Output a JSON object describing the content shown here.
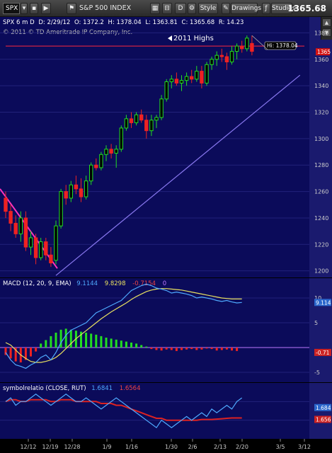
{
  "toolbar": {
    "symbol": "SPX",
    "symbol_name": "S&P 500 INDEX",
    "period": "D",
    "style_label": "Style",
    "drawings_label": "Drawings",
    "studies_label": "Studies",
    "last_price": "1365.68"
  },
  "header": {
    "symbol_info": "SPX 6 m D",
    "date": "D: 2/29/12",
    "open": "O: 1372.2",
    "high": "H: 1378.04",
    "low": "L: 1363.81",
    "close": "C: 1365.68",
    "range": "R: 14.23",
    "copyright": "© 2011 © TD Ameritrade IP Company, Inc."
  },
  "annotations": {
    "highs_label": "2011 Highs",
    "hi_label": "Hi: 1378.04",
    "price_badge": "1365"
  },
  "macd": {
    "legend": "MACD (12, 20, 9, EMA)",
    "value": "9.1144",
    "avg": "9.8298",
    "diff": "-0.7154",
    "zero": "0",
    "badge_value": "9.114",
    "badge_diff": "-0.71",
    "ticks": [
      "10",
      "5",
      "-5"
    ]
  },
  "relation": {
    "legend": "symbolrelatio (CLOSE, RUT)",
    "value1": "1.6841",
    "value2": "1.6564",
    "badge1": "1.684",
    "badge2": "1.656"
  },
  "price_axis": [
    "1380",
    "1360",
    "1340",
    "1320",
    "1300",
    "1280",
    "1260",
    "1240",
    "1220",
    "1200"
  ],
  "x_axis": [
    "12/12",
    "12/19",
    "12/28",
    "1/9",
    "1/16",
    "1/30",
    "2/6",
    "2/13",
    "2/20",
    "3/5",
    "3/12"
  ],
  "colors": {
    "up": "#22dd22",
    "down": "#ee2222",
    "resistance": "#cc2244",
    "trend": "#8877ee",
    "downtrend": "#ff33bb",
    "macd": "#4faaff",
    "signal": "#e8e060",
    "rel1": "#4faaff",
    "rel2": "#dd2222"
  },
  "chart_data": {
    "type": "candlestick",
    "title": "S&P 500 INDEX",
    "ylim": [
      1195,
      1392
    ],
    "candles": [
      {
        "o": 1255,
        "h": 1260,
        "l": 1240,
        "c": 1245
      },
      {
        "o": 1245,
        "h": 1250,
        "l": 1230,
        "c": 1236
      },
      {
        "o": 1236,
        "h": 1242,
        "l": 1225,
        "c": 1228
      },
      {
        "o": 1228,
        "h": 1245,
        "l": 1222,
        "c": 1240
      },
      {
        "o": 1240,
        "h": 1245,
        "l": 1215,
        "c": 1218
      },
      {
        "o": 1218,
        "h": 1230,
        "l": 1212,
        "c": 1225
      },
      {
        "o": 1225,
        "h": 1228,
        "l": 1205,
        "c": 1210
      },
      {
        "o": 1210,
        "h": 1225,
        "l": 1208,
        "c": 1222
      },
      {
        "o": 1222,
        "h": 1225,
        "l": 1208,
        "c": 1212
      },
      {
        "o": 1212,
        "h": 1218,
        "l": 1203,
        "c": 1206
      },
      {
        "o": 1208,
        "h": 1238,
        "l": 1205,
        "c": 1234
      },
      {
        "o": 1234,
        "h": 1262,
        "l": 1232,
        "c": 1260
      },
      {
        "o": 1260,
        "h": 1265,
        "l": 1250,
        "c": 1255
      },
      {
        "o": 1255,
        "h": 1268,
        "l": 1252,
        "c": 1265
      },
      {
        "o": 1265,
        "h": 1272,
        "l": 1258,
        "c": 1262
      },
      {
        "o": 1262,
        "h": 1270,
        "l": 1252,
        "c": 1256
      },
      {
        "o": 1256,
        "h": 1272,
        "l": 1254,
        "c": 1268
      },
      {
        "o": 1268,
        "h": 1282,
        "l": 1265,
        "c": 1280
      },
      {
        "o": 1280,
        "h": 1285,
        "l": 1276,
        "c": 1278
      },
      {
        "o": 1278,
        "h": 1290,
        "l": 1276,
        "c": 1288
      },
      {
        "o": 1288,
        "h": 1295,
        "l": 1283,
        "c": 1292
      },
      {
        "o": 1292,
        "h": 1296,
        "l": 1285,
        "c": 1289
      },
      {
        "o": 1289,
        "h": 1295,
        "l": 1278,
        "c": 1292
      },
      {
        "o": 1292,
        "h": 1310,
        "l": 1290,
        "c": 1308
      },
      {
        "o": 1308,
        "h": 1318,
        "l": 1306,
        "c": 1315
      },
      {
        "o": 1315,
        "h": 1320,
        "l": 1308,
        "c": 1312
      },
      {
        "o": 1312,
        "h": 1320,
        "l": 1310,
        "c": 1318
      },
      {
        "o": 1318,
        "h": 1322,
        "l": 1312,
        "c": 1314
      },
      {
        "o": 1314,
        "h": 1318,
        "l": 1300,
        "c": 1306
      },
      {
        "o": 1306,
        "h": 1318,
        "l": 1302,
        "c": 1314
      },
      {
        "o": 1314,
        "h": 1318,
        "l": 1308,
        "c": 1316
      },
      {
        "o": 1316,
        "h": 1333,
        "l": 1314,
        "c": 1330
      },
      {
        "o": 1330,
        "h": 1345,
        "l": 1328,
        "c": 1343
      },
      {
        "o": 1343,
        "h": 1348,
        "l": 1338,
        "c": 1345
      },
      {
        "o": 1345,
        "h": 1350,
        "l": 1340,
        "c": 1342
      },
      {
        "o": 1342,
        "h": 1348,
        "l": 1336,
        "c": 1344
      },
      {
        "o": 1344,
        "h": 1350,
        "l": 1340,
        "c": 1347
      },
      {
        "o": 1347,
        "h": 1352,
        "l": 1342,
        "c": 1345
      },
      {
        "o": 1345,
        "h": 1355,
        "l": 1343,
        "c": 1351
      },
      {
        "o": 1351,
        "h": 1355,
        "l": 1338,
        "c": 1342
      },
      {
        "o": 1342,
        "h": 1358,
        "l": 1340,
        "c": 1356
      },
      {
        "o": 1356,
        "h": 1362,
        "l": 1352,
        "c": 1360
      },
      {
        "o": 1360,
        "h": 1366,
        "l": 1355,
        "c": 1363
      },
      {
        "o": 1363,
        "h": 1368,
        "l": 1358,
        "c": 1362
      },
      {
        "o": 1362,
        "h": 1365,
        "l": 1352,
        "c": 1358
      },
      {
        "o": 1358,
        "h": 1370,
        "l": 1356,
        "c": 1366
      },
      {
        "o": 1366,
        "h": 1372,
        "l": 1360,
        "c": 1370
      },
      {
        "o": 1370,
        "h": 1374,
        "l": 1365,
        "c": 1368
      },
      {
        "o": 1368,
        "h": 1378,
        "l": 1366,
        "c": 1376
      },
      {
        "o": 1372,
        "h": 1378,
        "l": 1363,
        "c": 1366
      }
    ],
    "resistance": 1370,
    "uptrend": {
      "from": [
        10,
        1204
      ],
      "to": [
        58,
        1348
      ]
    },
    "downtrend": {
      "from": [
        0,
        1262
      ],
      "to": [
        10,
        1204
      ]
    },
    "macd_line": [
      -1.0,
      -2.5,
      -3.5,
      -3.8,
      -4.2,
      -3.5,
      -3.0,
      -2.0,
      -1.5,
      -2.5,
      -1.0,
      1.0,
      2.5,
      3.5,
      4.0,
      4.5,
      5.0,
      6.0,
      7.0,
      7.5,
      8.0,
      8.5,
      9.0,
      9.5,
      10.5,
      11.5,
      12.0,
      12.5,
      12.8,
      12.5,
      12.0,
      11.8,
      11.5,
      11.0,
      11.2,
      11.0,
      10.8,
      10.5,
      10.0,
      10.2,
      10.0,
      9.8,
      9.5,
      9.3,
      9.5,
      9.2,
      9.0,
      9.1
    ],
    "signal_line": [
      1.0,
      0.5,
      -0.5,
      -1.5,
      -2.2,
      -2.8,
      -3.0,
      -3.0,
      -2.8,
      -2.5,
      -2.0,
      -1.2,
      -0.2,
      0.8,
      1.8,
      2.6,
      3.4,
      4.2,
      5.0,
      5.8,
      6.5,
      7.2,
      7.8,
      8.4,
      9.0,
      9.7,
      10.3,
      10.8,
      11.3,
      11.6,
      11.8,
      11.9,
      11.9,
      11.8,
      11.7,
      11.6,
      11.4,
      11.2,
      11.0,
      10.8,
      10.6,
      10.4,
      10.2,
      10.0,
      9.9,
      9.8,
      9.8,
      9.8
    ],
    "histogram": [
      -1.5,
      -2.2,
      -2.8,
      -3.0,
      -2.5,
      -1.8,
      -0.8,
      0.8,
      1.5,
      2.3,
      3.0,
      3.6,
      3.8,
      3.6,
      3.4,
      3.2,
      3.0,
      2.8,
      2.6,
      2.3,
      2.0,
      1.8,
      1.6,
      1.4,
      1.2,
      1.0,
      0.8,
      0.5,
      0.2,
      -0.3,
      -0.5,
      -0.6,
      -0.4,
      -0.5,
      -0.7,
      -0.5,
      -0.4,
      -0.3,
      -0.5,
      -0.4,
      -0.2,
      -0.3,
      -0.6,
      -0.5,
      -0.4,
      -0.6,
      -0.7
    ],
    "relation_line1": [
      1.7,
      1.71,
      1.69,
      1.7,
      1.7,
      1.71,
      1.72,
      1.71,
      1.7,
      1.69,
      1.7,
      1.71,
      1.72,
      1.71,
      1.7,
      1.7,
      1.71,
      1.7,
      1.69,
      1.68,
      1.69,
      1.7,
      1.71,
      1.7,
      1.69,
      1.68,
      1.67,
      1.66,
      1.65,
      1.64,
      1.63,
      1.65,
      1.64,
      1.63,
      1.64,
      1.65,
      1.66,
      1.65,
      1.66,
      1.67,
      1.66,
      1.68,
      1.67,
      1.68,
      1.69,
      1.68,
      1.7,
      1.71
    ],
    "relation_line2": [
      1.7,
      1.705,
      1.705,
      1.7,
      1.7,
      1.705,
      1.705,
      1.705,
      1.705,
      1.7,
      1.7,
      1.705,
      1.705,
      1.705,
      1.7,
      1.7,
      1.7,
      1.7,
      1.7,
      1.695,
      1.695,
      1.695,
      1.69,
      1.69,
      1.685,
      1.68,
      1.675,
      1.67,
      1.665,
      1.66,
      1.655,
      1.655,
      1.65,
      1.65,
      1.65,
      1.65,
      1.65,
      1.65,
      1.65,
      1.652,
      1.652,
      1.652,
      1.653,
      1.654,
      1.655,
      1.656,
      1.656,
      1.656
    ]
  }
}
